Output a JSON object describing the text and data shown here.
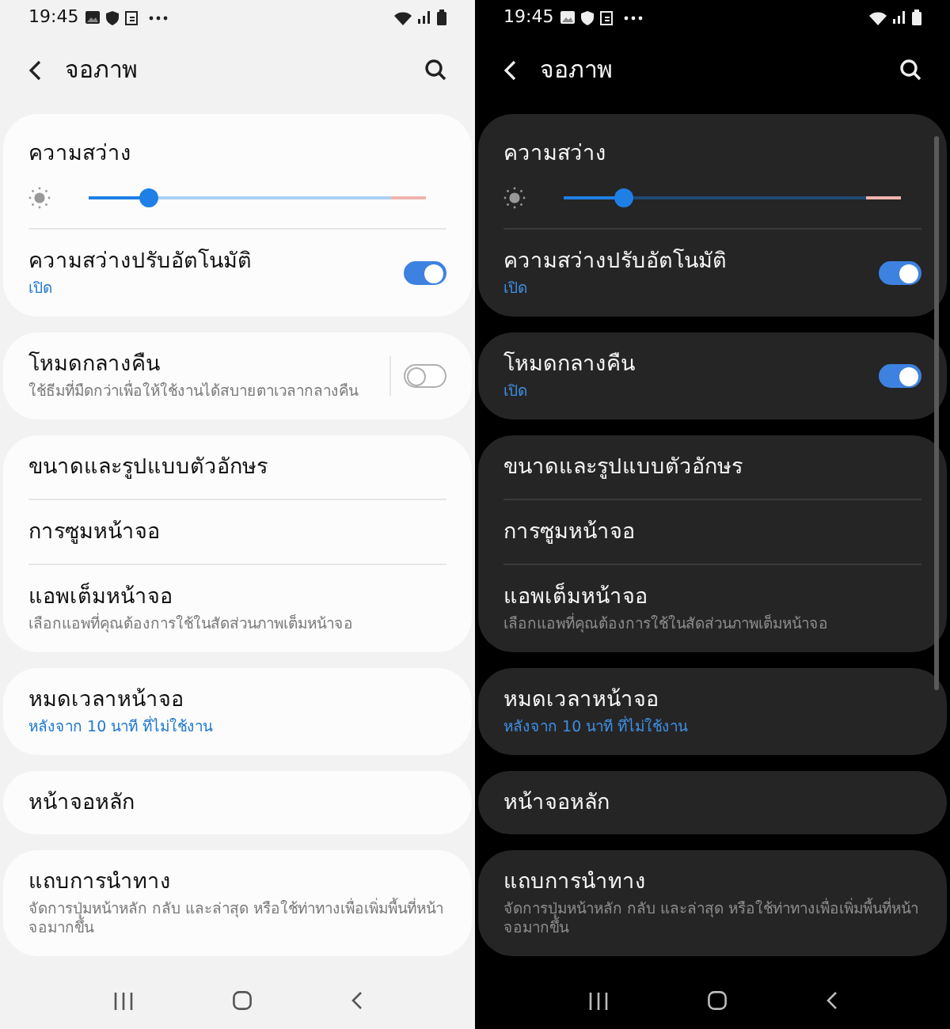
{
  "screens": [
    {
      "kind": "light",
      "status_bar": {
        "time": "19:45"
      },
      "header": {
        "title": "จอภาพ"
      },
      "brightness": {
        "label": "ความสว่าง",
        "level": 0.18
      },
      "groups": [
        [
          {
            "kind": "toggle",
            "title": "ความสว่างปรับอัตโนมัติ",
            "subtitle": "เปิด",
            "accent": true,
            "on": true
          }
        ],
        [
          {
            "kind": "toggle",
            "title": "โหมดกลางคืน",
            "subtitle": "ใช้ธีมที่มืดกว่าเพื่อให้ใช้งานได้สบายตาเวลากลางคืน",
            "accent": false,
            "on": false
          }
        ],
        [
          {
            "kind": "link",
            "title": "ขนาดและรูปแบบตัวอักษร"
          },
          {
            "kind": "link",
            "title": "การซูมหน้าจอ"
          },
          {
            "kind": "link",
            "title": "แอพเต็มหน้าจอ",
            "subtitle": "เลือกแอพที่คุณต้องการใช้ในสัดส่วนภาพเต็มหน้าจอ",
            "accent": false
          }
        ],
        [
          {
            "kind": "link",
            "title": "หมดเวลาหน้าจอ",
            "subtitle": "หลังจาก 10 นาที ที่ไม่ใช้งาน",
            "accent": true
          }
        ],
        [
          {
            "kind": "link",
            "title": "หน้าจอหลัก"
          }
        ],
        [
          {
            "kind": "link",
            "title": "แถบการนำทาง",
            "subtitle": "จัดการปุ่มหน้าหลัก กลับ และล่าสุด หรือใช้ท่าทางเพื่อเพิ่มพื้นที่หน้าจอมากขึ้น",
            "accent": false
          }
        ]
      ]
    },
    {
      "kind": "dark",
      "status_bar": {
        "time": "19:45"
      },
      "header": {
        "title": "จอภาพ"
      },
      "brightness": {
        "label": "ความสว่าง",
        "level": 0.18
      },
      "groups": [
        [
          {
            "kind": "toggle",
            "title": "ความสว่างปรับอัตโนมัติ",
            "subtitle": "เปิด",
            "accent": true,
            "on": true
          }
        ],
        [
          {
            "kind": "toggle",
            "title": "โหมดกลางคืน",
            "subtitle": "เปิด",
            "accent": true,
            "on": true
          }
        ],
        [
          {
            "kind": "link",
            "title": "ขนาดและรูปแบบตัวอักษร"
          },
          {
            "kind": "link",
            "title": "การซูมหน้าจอ"
          },
          {
            "kind": "link",
            "title": "แอพเต็มหน้าจอ",
            "subtitle": "เลือกแอพที่คุณต้องการใช้ในสัดส่วนภาพเต็มหน้าจอ",
            "accent": false
          }
        ],
        [
          {
            "kind": "link",
            "title": "หมดเวลาหน้าจอ",
            "subtitle": "หลังจาก 10 นาที ที่ไม่ใช้งาน",
            "accent": true
          }
        ],
        [
          {
            "kind": "link",
            "title": "หน้าจอหลัก"
          }
        ],
        [
          {
            "kind": "link",
            "title": "แถบการนำทาง",
            "subtitle": "จัดการปุ่มหน้าหลัก กลับ และล่าสุด หรือใช้ท่าทางเพื่อเพิ่มพื้นที่หน้าจอมากขึ้น",
            "accent": false
          }
        ]
      ]
    }
  ]
}
